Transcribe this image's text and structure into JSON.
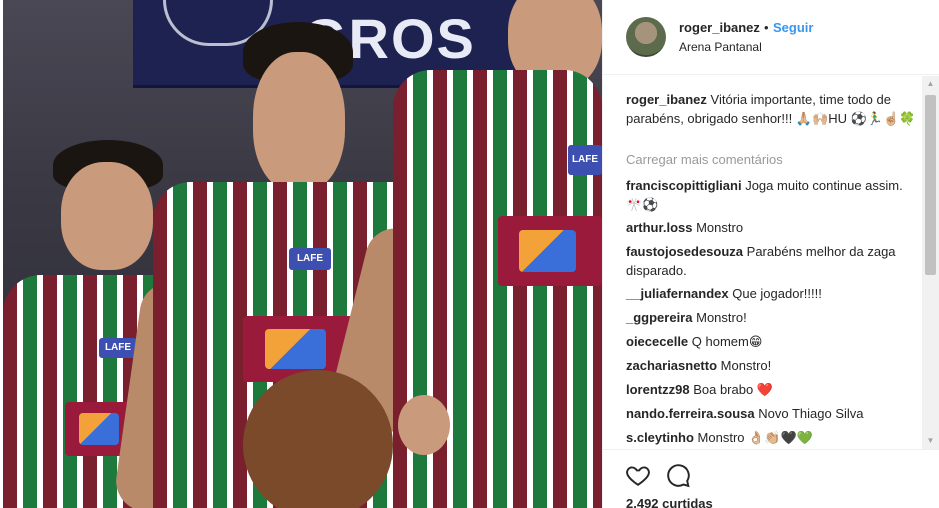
{
  "photo": {
    "banner_text": "GROS",
    "sponsor_badge": "LAFE"
  },
  "header": {
    "username": "roger_ibanez",
    "separator": "•",
    "follow_label": "Seguir",
    "location": "Arena Pantanal",
    "avatar_icon": "profile-avatar"
  },
  "caption": {
    "username": "roger_ibanez",
    "text": "Vitória importante, time todo de parabéns, obrigado senhor!!! 🙏🏼🙌🏼HU ⚽🏃‍♂️☝🏼🍀"
  },
  "load_more_label": "Carregar mais comentários",
  "comments": [
    {
      "username": "franciscopittigliani",
      "text": "Joga muito continue assim. 🎌⚽"
    },
    {
      "username": "arthur.loss",
      "text": "Monstro"
    },
    {
      "username": "faustojosedesouza",
      "text": "Parabéns melhor da zaga disparado."
    },
    {
      "username": "__juliafernandex",
      "text": "Que jogador!!!!!"
    },
    {
      "username": "_ggpereira",
      "text": "Monstro!"
    },
    {
      "username": "oiececelle",
      "text": "Q homem😁"
    },
    {
      "username": "zachariasnetto",
      "text": "Monstro!"
    },
    {
      "username": "lorentzz98",
      "text": "Boa brabo ❤️"
    },
    {
      "username": "nando.ferreira.sousa",
      "text": "Novo Thiago Silva"
    },
    {
      "username": "s.cleytinho",
      "text": "Monstro 👌🏼👏🏼🖤💚"
    }
  ],
  "actions": {
    "like_icon": "heart-icon",
    "comment_icon": "comment-icon",
    "likes_text": "2.492 curtidas"
  },
  "colors": {
    "link_blue": "#3897f0",
    "text": "#262626",
    "muted": "#999999",
    "fluminense_red": "#7a1f2e",
    "fluminense_green": "#1e7a3c"
  }
}
